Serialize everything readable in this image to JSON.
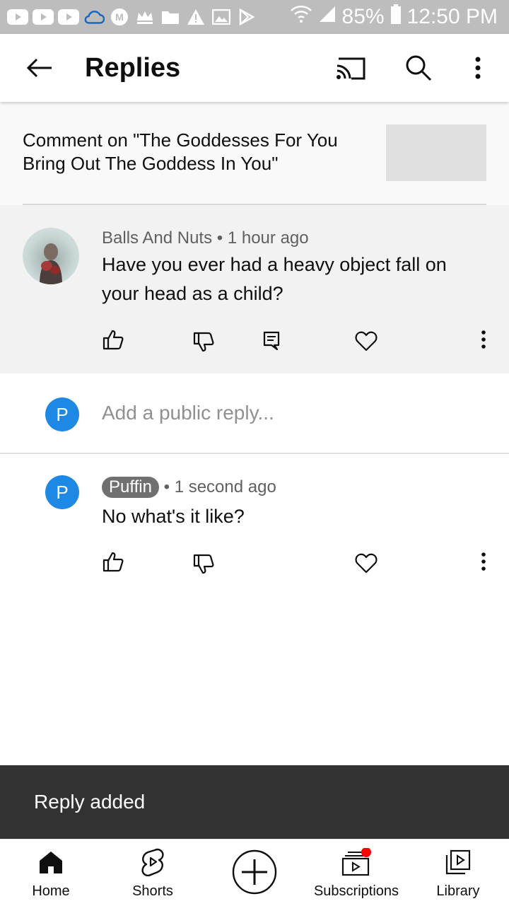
{
  "status_bar": {
    "battery": "85%",
    "time": "12:50 PM",
    "icons": [
      "youtube-icon",
      "youtube-icon",
      "youtube-icon",
      "cloud-icon",
      "m-badge-icon",
      "crown-icon",
      "folder-icon",
      "warning-icon",
      "image-icon",
      "play-store-icon",
      "wifi-icon",
      "signal-icon",
      "battery-icon"
    ]
  },
  "app_bar": {
    "title": "Replies",
    "icons": [
      "back-arrow-icon",
      "cast-icon",
      "search-icon",
      "more-vert-icon"
    ]
  },
  "context": {
    "comment_on": "Comment on \"The Goddesses For You Bring Out The Goddess In You\""
  },
  "original_comment": {
    "author": "Balls And Nuts",
    "time": "1 hour ago",
    "text": "Have you ever had a heavy object fall on your head as a child?",
    "actions": [
      "like-icon",
      "dislike-icon",
      "reply-icon",
      "heart-icon",
      "more-vert-icon"
    ]
  },
  "reply_box": {
    "avatar_letter": "P",
    "placeholder": "Add a public reply..."
  },
  "reply": {
    "avatar_letter": "P",
    "author": "Puffin",
    "time": "1 second ago",
    "text": "No what's it like?",
    "actions": [
      "like-icon",
      "dislike-icon",
      "heart-icon",
      "more-vert-icon"
    ]
  },
  "snackbar": {
    "text": "Reply added"
  },
  "bottom_nav": {
    "items": [
      {
        "label": "Home",
        "icon": "home-icon"
      },
      {
        "label": "Shorts",
        "icon": "shorts-icon"
      },
      {
        "label": "",
        "icon": "create-plus-icon"
      },
      {
        "label": "Subscriptions",
        "icon": "subscriptions-icon"
      },
      {
        "label": "Library",
        "icon": "library-icon"
      }
    ]
  },
  "colors": {
    "status_bar_bg": "#bdbdbd",
    "avatar_blue": "#1e88e5",
    "notification_red": "#ff0000",
    "snackbar_bg": "#323232"
  }
}
